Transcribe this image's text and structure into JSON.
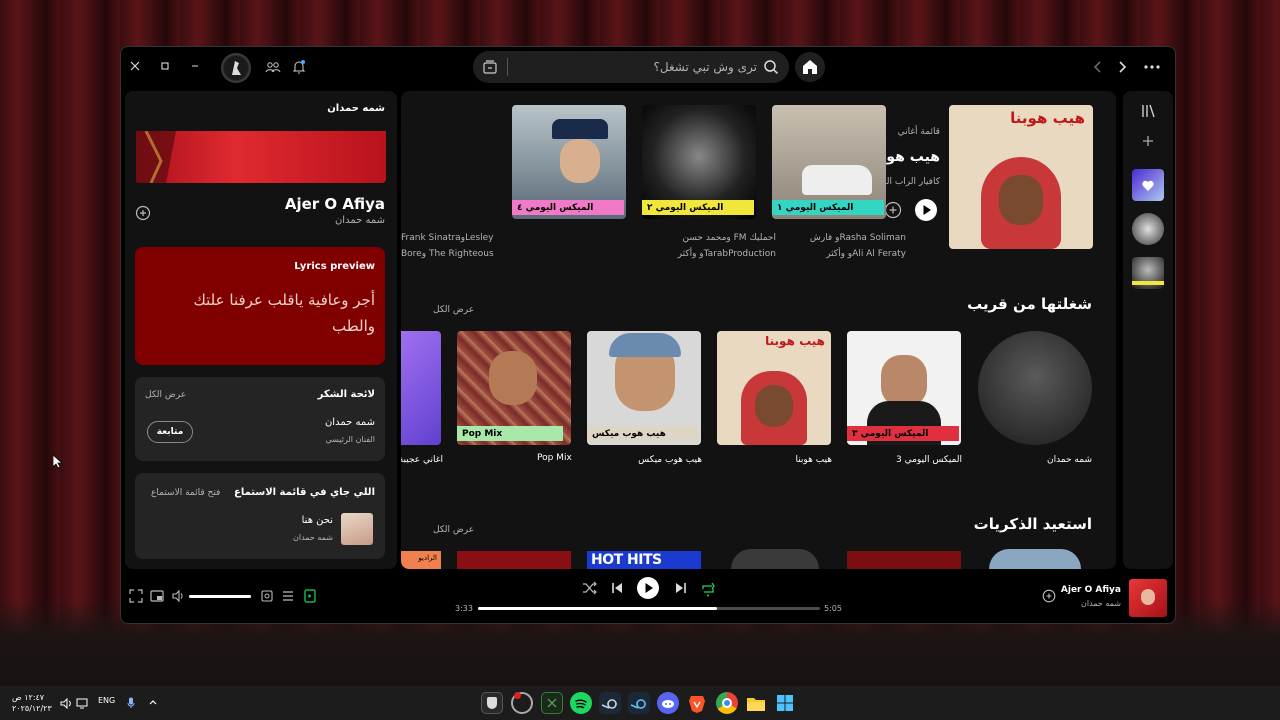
{
  "topbar": {
    "search_placeholder": "ترى وش تبي تشغل؟",
    "window_controls": [
      "close-icon",
      "maximize-icon",
      "minimize-icon"
    ],
    "icons": [
      "friends-icon",
      "bell-icon",
      "browse-icon",
      "search-icon",
      "home-icon",
      "back-icon",
      "forward-icon",
      "more-icon"
    ]
  },
  "now_playing_view": {
    "artist_header": "شمه حمدان",
    "track_title": "Ajer O Afiya",
    "track_artist": "شمه حمدان",
    "lyrics_label": "Lyrics preview",
    "lyrics_text": "أجر وعافية ياقلب عرفنا علتك والطب",
    "credits_title": "لائحة الشكر",
    "credits_show_all": "عرض الكل",
    "credit_name": "شمه حمدان",
    "credit_role": "الفنان الرئيسي",
    "follow_label": "متابعة",
    "queue_title": "اللي جاي في قائمة الاستماع",
    "queue_open": "فتح قائمة الاستماع",
    "queue_track": "نحن هنا",
    "queue_artist": "شمه حمدان"
  },
  "main": {
    "featured": {
      "type_label": "قائمة أغاني",
      "title": "هيب هوبنا",
      "subtitle": "كافيار الراب المحلّي",
      "cover_text": "هيب هوبنا"
    },
    "mixes": [
      {
        "band": "الميكس اليومي ١",
        "line1": "Rasha Solimanو فارش",
        "line2": "Ali Al Feratyو وأكثر",
        "band_color": "#33d6c4"
      },
      {
        "band": "الميكس اليومي ٢",
        "line1": "احمليك FM ومحمد حسن",
        "line2": "TarabProductionو وأكثر",
        "band_color": "#f0e63c"
      },
      {
        "band": "الميكس اليومي ٤",
        "line1": "Frank SinatraوLesley",
        "line2": "Boreو The Righteous",
        "band_color": "#f07ac8"
      }
    ],
    "recent_title": "شغلتها من قريب",
    "recent_show_all": "عرض الكل",
    "recent": [
      {
        "label": "شمه حمدان"
      },
      {
        "label": "الميكس اليومي 3",
        "band": "الميكس اليومي ٣"
      },
      {
        "label": "هيب هوبنا",
        "cover_text": "هيب هوبنا"
      },
      {
        "label": "هيب هوب ميكس",
        "band": "هيب هوب ميكس"
      },
      {
        "label": "Pop Mix",
        "band": "Pop Mix"
      },
      {
        "label": "أغاني عجيبة"
      }
    ],
    "memories_title": "استعيد الذكريات",
    "memories_show_all": "عرض الكل",
    "memories_hot": "HOT HITS",
    "memories_radio": "الراديو"
  },
  "player": {
    "track_title": "Ajer O Afiya",
    "track_artist": "شمه حمدان",
    "elapsed": "3:33",
    "duration": "5:05",
    "progress": 0.7,
    "volume": 1.0
  },
  "taskbar": {
    "time": "١٢:٤٧ ص",
    "date": "٢٠٢٥/١٢/٢٣",
    "lang": "ENG"
  },
  "colors": {
    "accent": "#1ed760",
    "lyrics_bg": "#800000"
  }
}
